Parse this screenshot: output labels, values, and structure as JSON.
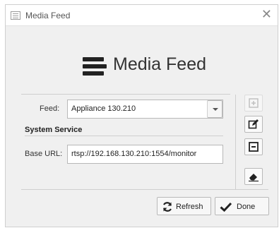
{
  "window": {
    "title": "Media Feed"
  },
  "header": {
    "logo_text": "Media Feed"
  },
  "form": {
    "feed_label": "Feed:",
    "feed_value": "Appliance 130.210",
    "section_title": "System Service",
    "base_url_label": "Base URL:",
    "base_url_value": "rtsp://192.168.130.210:1554/monitor"
  },
  "side_buttons": [
    "add",
    "edit",
    "remove",
    "erase"
  ],
  "footer": {
    "refresh_label": "Refresh",
    "done_label": "Done"
  }
}
